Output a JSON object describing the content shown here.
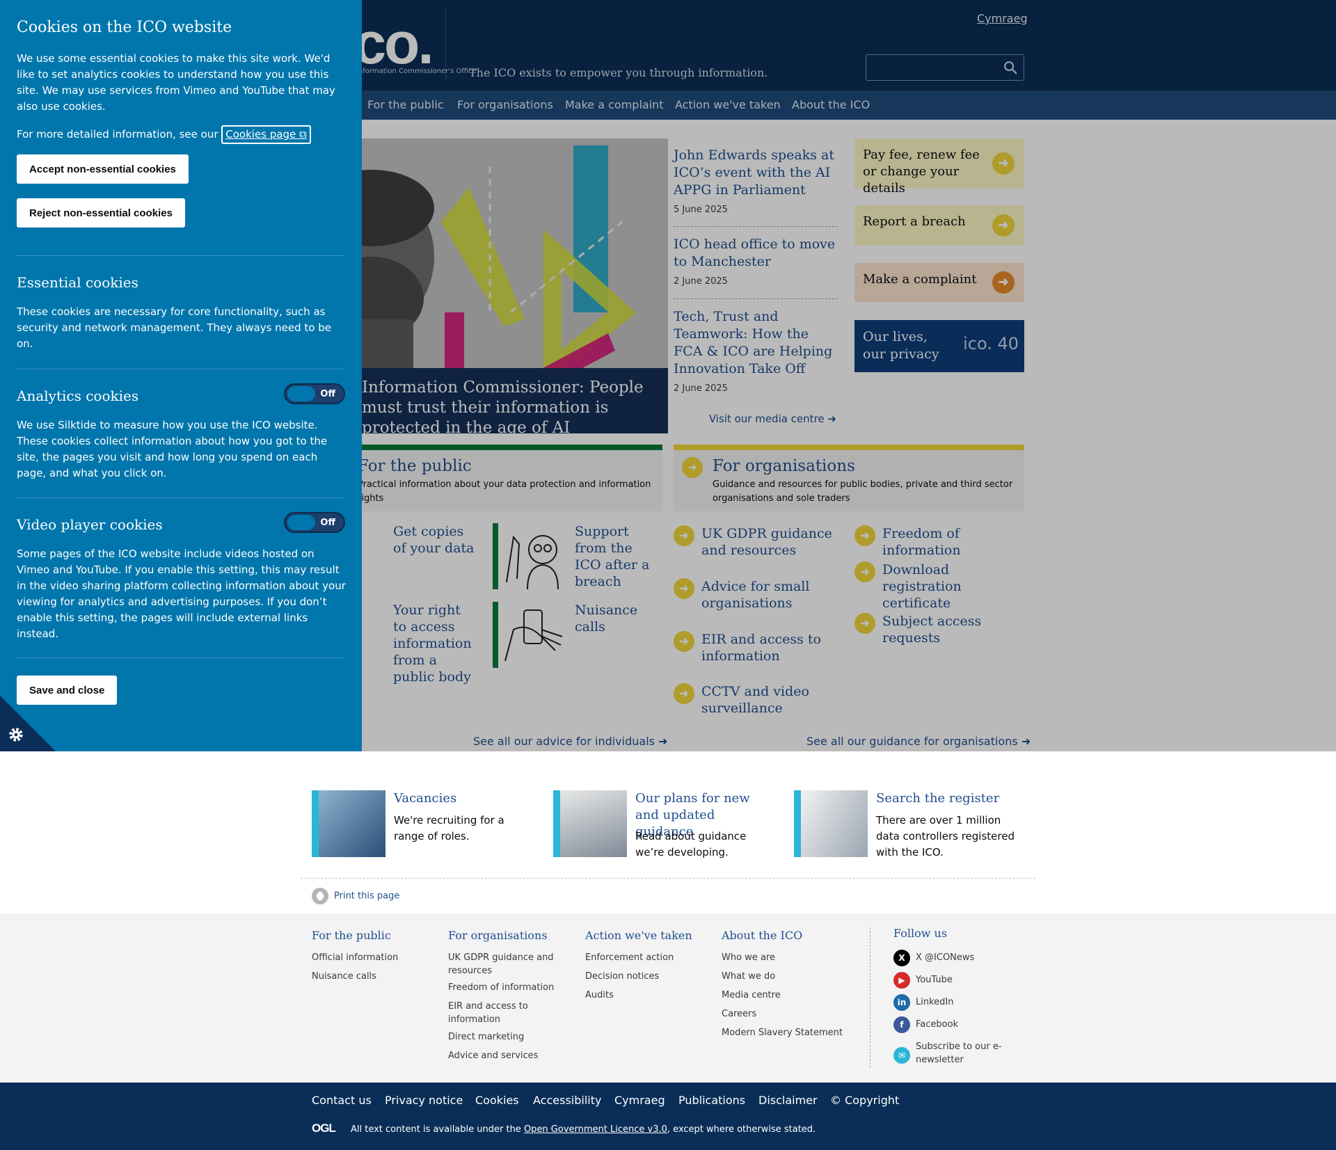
{
  "header": {
    "logo_text": "ico.",
    "logo_subtitle": "Information Commissioner's Office",
    "tagline": "The ICO exists to empower you through information.",
    "language_link": "Cymraeg",
    "search_placeholder": ""
  },
  "nav": {
    "items": [
      {
        "label": "For the public"
      },
      {
        "label": "For organisations"
      },
      {
        "label": "Make a complaint"
      },
      {
        "label": "Action we've taken"
      },
      {
        "label": "About the ICO"
      }
    ]
  },
  "hero": {
    "caption": "Information Commissioner: People must trust their information is protected in the age of AI"
  },
  "news": {
    "items": [
      {
        "title": "John Edwards speaks at ICO’s event with the AI APPG in Parliament",
        "date": "5 June 2025"
      },
      {
        "title": "ICO head office to move to Manchester",
        "date": "2 June 2025"
      },
      {
        "title": "Tech, Trust and Teamwork: How the FCA & ICO are Helping Innovation Take Off",
        "date": "2 June 2025"
      }
    ],
    "media_link": "Visit our media centre"
  },
  "quick_links": {
    "fee": "Pay fee, renew fee or change your details",
    "breach": "Report a breach",
    "complaint": "Make a complaint",
    "privacy": "Our lives, our privacy",
    "privacy_badge": "ico. 40"
  },
  "public_section": {
    "title": "For the public",
    "description": "Practical information about your data protection and information rights",
    "cards": [
      {
        "label": "Get copies of your data"
      },
      {
        "label": "Support from the ICO after a breach"
      },
      {
        "label": "Your right to access information from a public body"
      },
      {
        "label": "Nuisance calls"
      }
    ],
    "see_all": "See all our advice for individuals"
  },
  "org_section": {
    "title": "For organisations",
    "description": "Guidance and resources for public bodies, private and third sector organisations and sole traders",
    "items_left": [
      {
        "label": "UK GDPR guidance and resources"
      },
      {
        "label": "Advice for small organisations"
      },
      {
        "label": "EIR and access to information"
      },
      {
        "label": "CCTV and video surveillance"
      }
    ],
    "items_right": [
      {
        "label": "Freedom of information"
      },
      {
        "label": "Download registration certificate"
      },
      {
        "label": "Subject access requests"
      }
    ],
    "see_all": "See all our guidance for organisations"
  },
  "promos": [
    {
      "title": "Vacancies",
      "desc": "We're recruiting for a range of roles."
    },
    {
      "title": "Our plans for new and updated guidance",
      "desc": "Read about guidance we’re developing."
    },
    {
      "title": "Search the register",
      "desc": "There are over 1 million data controllers registered with the ICO."
    }
  ],
  "print_label": "Print this page",
  "footer": {
    "cols": [
      {
        "heading": "For the public",
        "links": [
          "Official information",
          "Nuisance calls"
        ]
      },
      {
        "heading": "For organisations",
        "links": [
          "UK GDPR guidance and resources",
          "Freedom of information",
          "EIR and access to information",
          "Direct marketing",
          "Advice and services"
        ]
      },
      {
        "heading": "Action we've taken",
        "links": [
          "Enforcement action",
          "Decision notices",
          "Audits"
        ]
      },
      {
        "heading": "About the ICO",
        "links": [
          "Who we are",
          "What we do",
          "Media centre",
          "Careers",
          "Modern Slavery Statement"
        ]
      }
    ],
    "follow_heading": "Follow us",
    "social": [
      {
        "label": "X @ICONews",
        "icon": "x-icon",
        "color": "#000000"
      },
      {
        "label": "YouTube",
        "icon": "youtube-icon",
        "color": "#d62a2a"
      },
      {
        "label": "LinkedIn",
        "icon": "linkedin-icon",
        "color": "#1f6aa8"
      },
      {
        "label": "Facebook",
        "icon": "facebook-icon",
        "color": "#3b5998"
      },
      {
        "label": "Subscribe to our e-newsletter",
        "icon": "email-icon",
        "color": "#2bb6d8"
      }
    ]
  },
  "bottom_bar": {
    "links": [
      "Contact us",
      "Privacy notice",
      "Cookies",
      "Accessibility",
      "Cymraeg",
      "Publications",
      "Disclaimer",
      "© Copyright"
    ],
    "ogl": "OGL",
    "licence_prefix": "All text content is available under the ",
    "licence_link": "Open Government Licence v3.0",
    "licence_suffix": ", except where otherwise stated."
  },
  "cookie_banner": {
    "title": "Cookies on the ICO website",
    "intro": "We use some essential cookies to make this site work. We'd like to set analytics cookies to understand how you use this site. We may use services from Vimeo and YouTube that may also use cookies.",
    "more_info_prefix": "For more detailed information, see our ",
    "cookies_page_link": "Cookies page",
    "accept_label": "Accept non-essential cookies",
    "reject_label": "Reject non-essential cookies",
    "essential_title": "Essential cookies",
    "essential_text": "These cookies are necessary for core functionality, such as security and network management. They always need to be on.",
    "analytics_title": "Analytics cookies",
    "analytics_state": "Off",
    "analytics_text": "We use Silktide to measure how you use the ICO website. These cookies collect information about how you got to the site, the pages you visit and how long you spend on each page, and what you click on.",
    "video_title": "Video player cookies",
    "video_state": "Off",
    "video_text": "Some pages of the ICO website include videos hosted on Vimeo and YouTube. If you enable this setting, this may result in the video sharing platform collecting information about your viewing for analytics and advertising purposes. If you don’t enable this setting, the pages will include external links instead.",
    "save_label": "Save and close"
  },
  "colors": {
    "header_bg": "#0a2e57",
    "cookie_bg": "#0076ac",
    "link": "#1f4f8f",
    "accent_yellow": "#f1d63a",
    "accent_green": "#0b7a3a",
    "accent_cyan": "#2bb6d8"
  }
}
